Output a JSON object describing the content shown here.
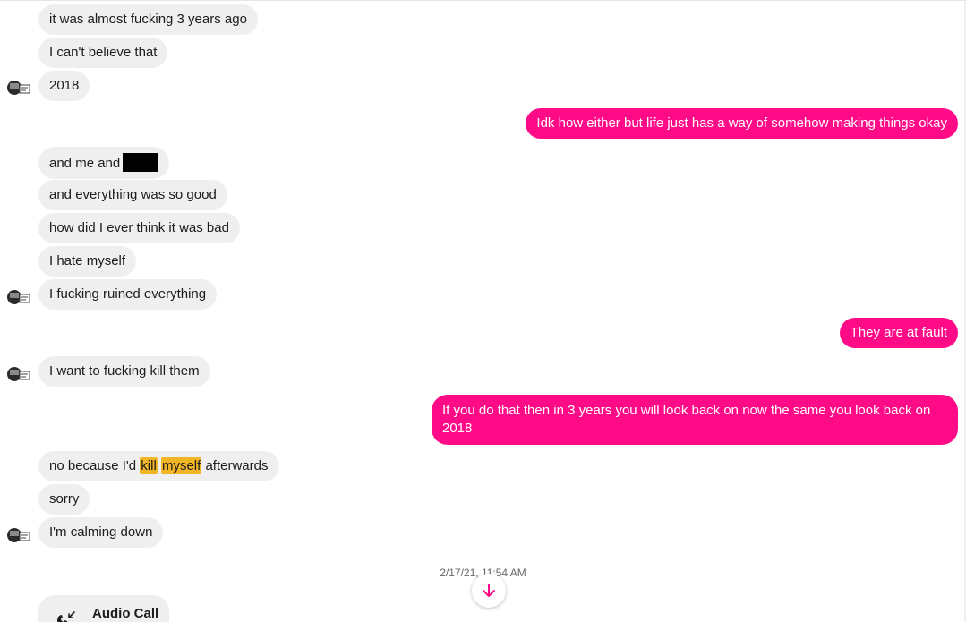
{
  "messages_in_1": [
    "it was almost fucking 3 years ago",
    "I can't believe that",
    "2018"
  ],
  "messages_out_1": "Idk how either but life just has a way of somehow making things okay",
  "messages_in_2": {
    "m1_prefix": "and me and",
    "m2": "and everything was so good",
    "m3": "how did I ever think it was bad",
    "m4": "I hate myself",
    "m5": "I fucking ruined everything"
  },
  "messages_out_2": "They are at fault",
  "messages_in_3": "I want to fucking kill them",
  "messages_out_3": "If you do that then in 3 years you will look back on now the same you look back on 2018",
  "messages_in_4": {
    "m1_prefix": "no because I'd ",
    "m1_hl1": "kill",
    "m1_space": " ",
    "m1_hl2": "myself",
    "m1_suffix": " afterwards",
    "m2": "sorry",
    "m3": "I'm calming down"
  },
  "timestamp": "2/17/21, 11:54 AM",
  "call": {
    "label": "Audio Call"
  },
  "colors": {
    "outgoing": "#ff0a87",
    "incoming": "#efefef",
    "highlight": "#f2b526"
  }
}
